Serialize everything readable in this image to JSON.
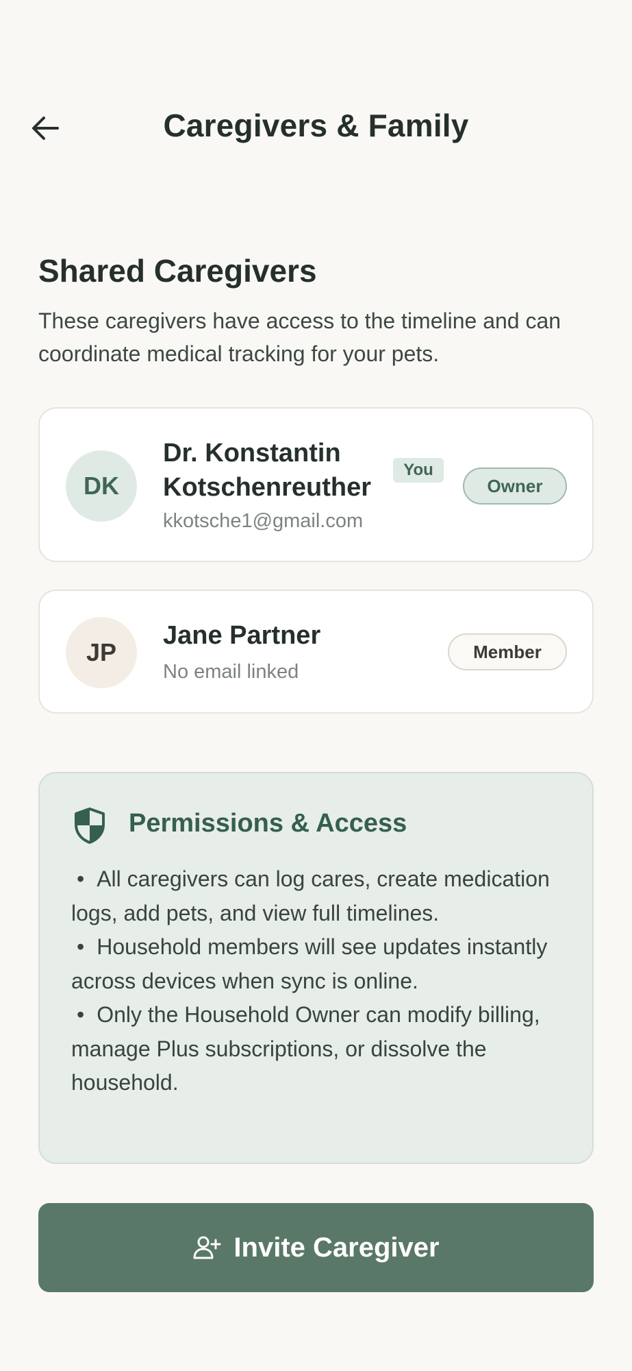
{
  "header": {
    "back_icon": "arrow-left-icon",
    "title": "Caregivers & Family"
  },
  "section": {
    "title": "Shared Caregivers",
    "description": "These caregivers have access to the timeline and can coordinate medical tracking for your pets."
  },
  "caregivers": [
    {
      "initials": "DK",
      "name": "Dr. Konstantin Kotschenreuther",
      "self_badge": "You",
      "email": "kkotsche1@gmail.com",
      "role": "Owner"
    },
    {
      "initials": "JP",
      "name": "Jane Partner",
      "email": "No email linked",
      "role": "Member"
    }
  ],
  "permissions": {
    "icon": "shield-icon",
    "title": "Permissions & Access",
    "items": [
      "All caregivers can log cares, create medication logs, add pets, and view full timelines.",
      "Household members will see updates instantly across devices when sync is online.",
      "Only the Household Owner can modify billing, manage Plus subscriptions, or dissolve the household."
    ]
  },
  "invite_button": {
    "icon": "user-plus-icon",
    "label": "Invite Caregiver"
  },
  "colors": {
    "background": "#faf8f5",
    "accent": "#5a7868",
    "accent_soft": "#dfeae4",
    "permissions_bg": "#e7ede8"
  }
}
